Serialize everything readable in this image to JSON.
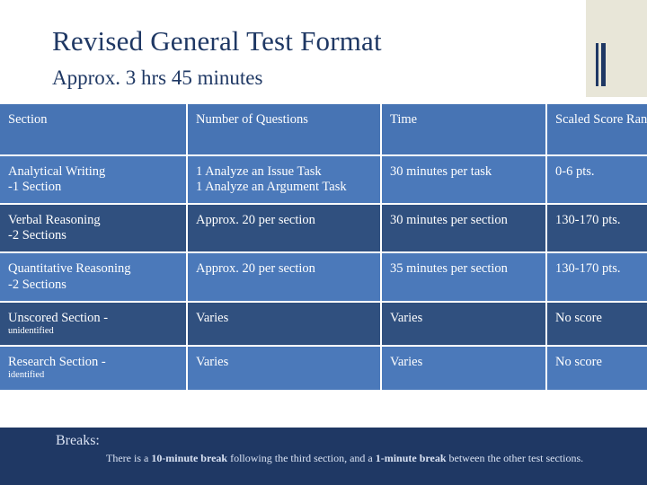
{
  "slide": {
    "title": "Revised General Test Format",
    "subtitle": "Approx. 3 hrs 45 minutes"
  },
  "table": {
    "headers": [
      "Section",
      "Number of Questions",
      "Time",
      "Scaled Score Range"
    ],
    "rows": [
      {
        "section_line1": "Analytical Writing",
        "section_line2": "-1 Section",
        "questions_line1": "1 Analyze an Issue Task",
        "questions_line2": "1 Analyze an Argument Task",
        "time_line1": "30 minutes per task",
        "score": "0-6 pts."
      },
      {
        "section_line1": "Verbal Reasoning",
        "section_line2": "-2 Sections",
        "questions_line1": "Approx. 20 per section",
        "questions_line2": "",
        "time_line1": "30 minutes per section",
        "score": "130-170 pts."
      },
      {
        "section_line1": "Quantitative Reasoning",
        "section_line2": "-2 Sections",
        "questions_line1": "Approx. 20 per section",
        "questions_line2": "",
        "time_line1": "35 minutes per section",
        "score": "130-170 pts."
      },
      {
        "section_line1": "Unscored Section -",
        "section_line2": "unidentified",
        "questions_line1": "Varies",
        "questions_line2": "",
        "time_line1": "Varies",
        "score": "No score"
      },
      {
        "section_line1": "Research Section -",
        "section_line2": "identified",
        "questions_line1": "Varies",
        "questions_line2": "",
        "time_line1": "Varies",
        "score": "No score"
      }
    ]
  },
  "footer": {
    "label": "Breaks:",
    "text_part1": "There is a ",
    "text_bold1": "10-minute break",
    "text_part2": " following the third section, and a ",
    "text_bold2": "1-minute break",
    "text_part3": " between the other test sections."
  },
  "colors": {
    "navy": "#1f3864",
    "header_blue": "#4774b4",
    "row_light": "#4b79ba",
    "row_dark": "#30507f",
    "corner_cream": "#e8e6d8"
  }
}
